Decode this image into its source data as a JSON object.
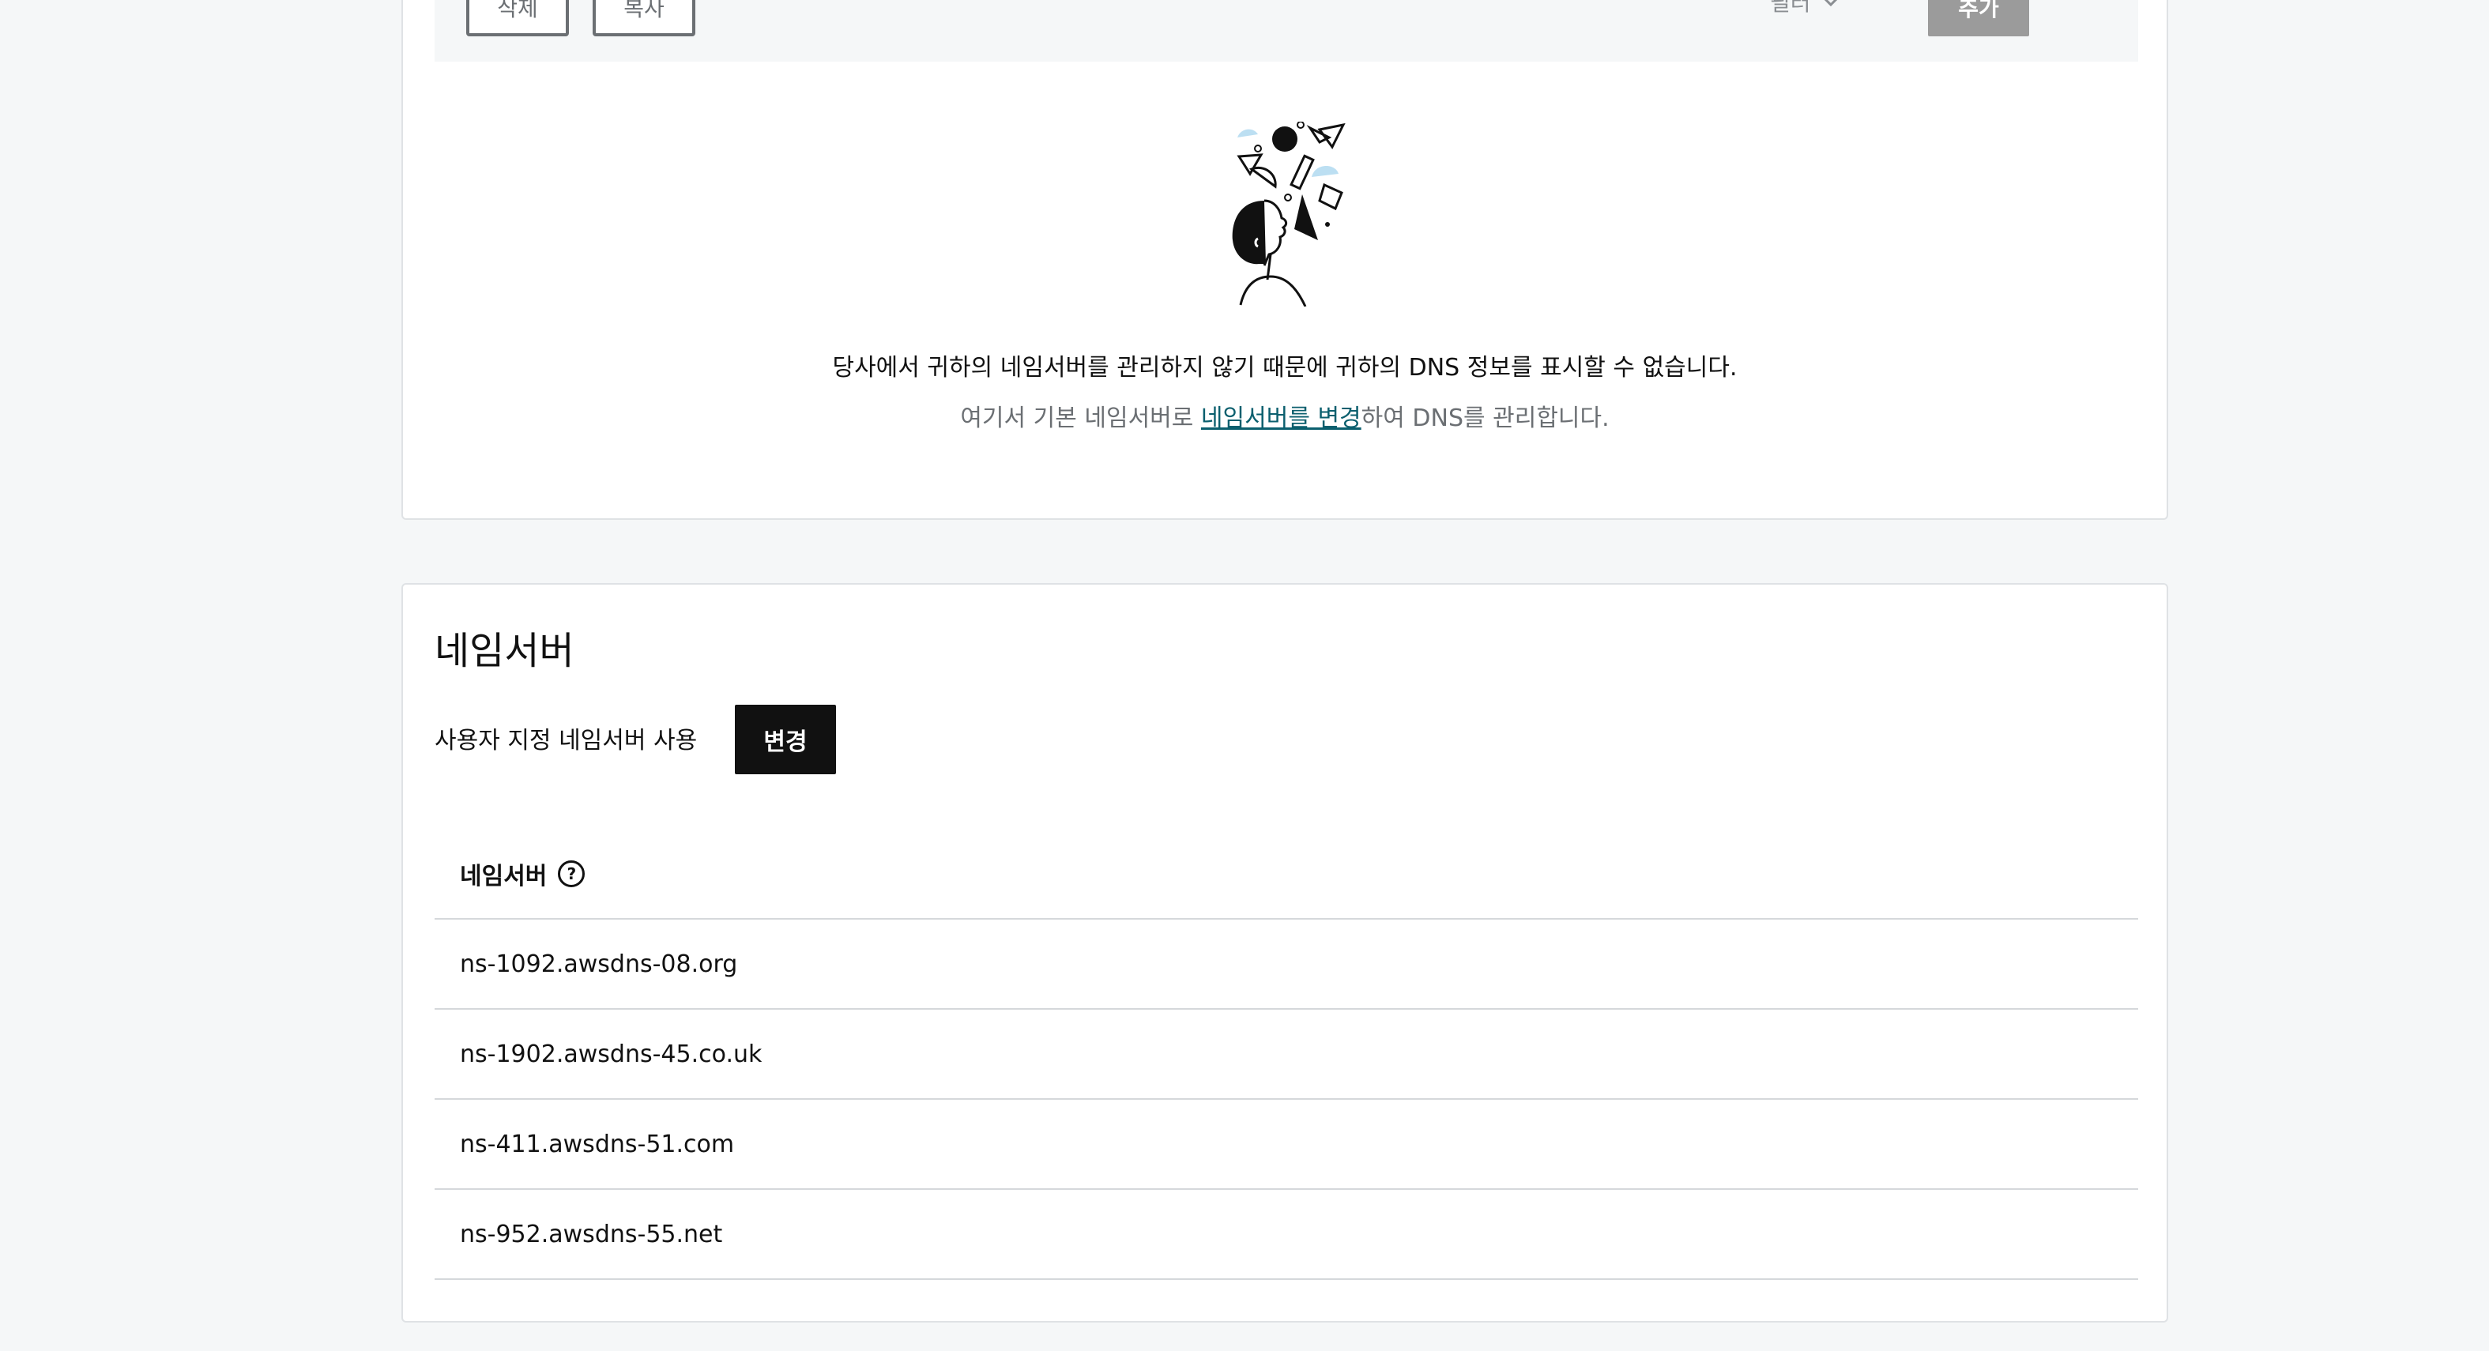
{
  "toolbar": {
    "delete_label": "삭제",
    "copy_label": "복사",
    "filter_label": "필터",
    "add_label": "추가",
    "more_label": "···"
  },
  "empty_state": {
    "message": "당사에서 귀하의 네임서버를 관리하지 않기 때문에 귀하의 DNS 정보를 표시할 수 없습니다.",
    "sub_prefix": "여기서 기본 네임서버로 ",
    "sub_link": "네임서버를 변경",
    "sub_suffix": "하여 DNS를 관리합니다."
  },
  "nameservers_section": {
    "title": "네임서버",
    "status_label": "사용자 지정 네임서버 사용",
    "change_button": "변경",
    "table_header": "네임서버",
    "help_icon": "question-circle-icon",
    "rows": [
      "ns-1092.awsdns-08.org",
      "ns-1902.awsdns-45.co.uk",
      "ns-411.awsdns-51.com",
      "ns-952.awsdns-55.net"
    ]
  }
}
